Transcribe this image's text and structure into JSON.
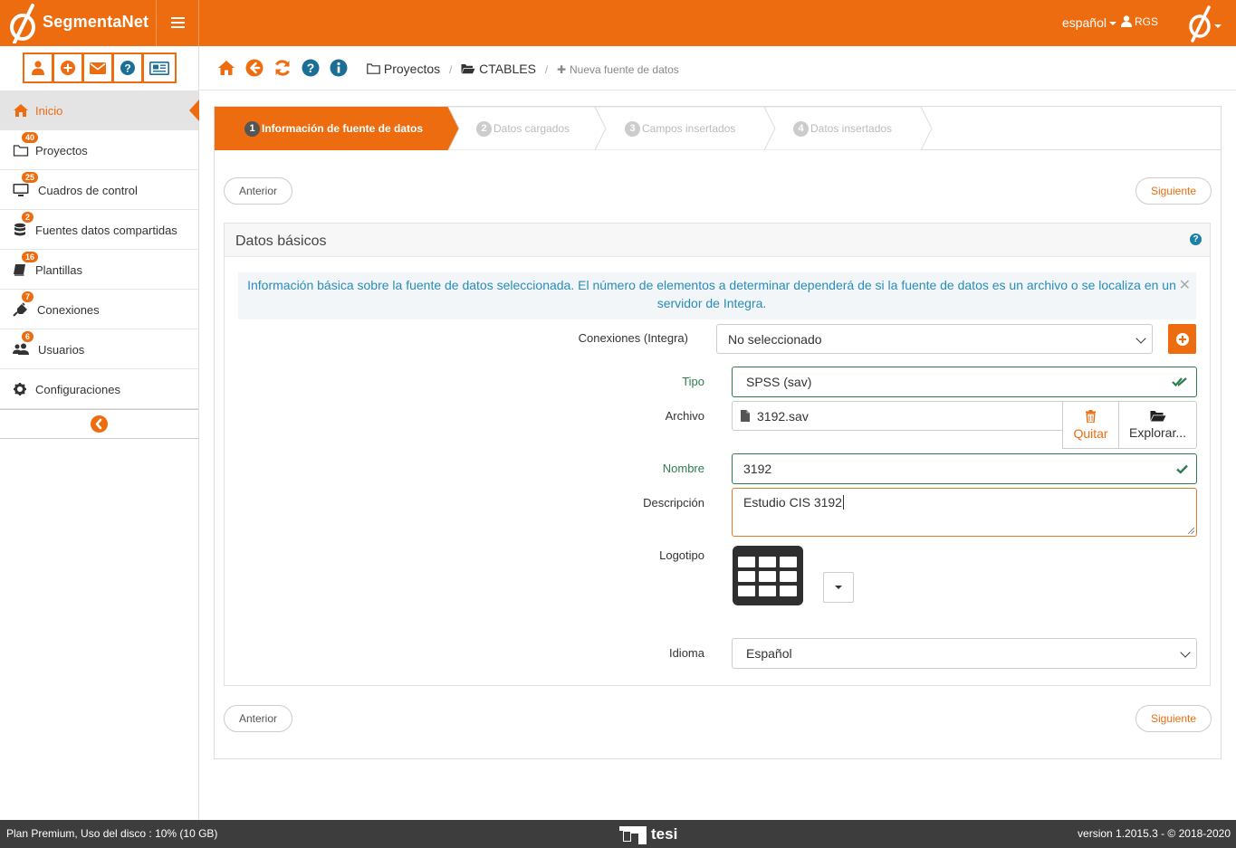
{
  "brand": {
    "name": "SegmentaNet"
  },
  "topbar": {
    "language": "español",
    "user": "RGS"
  },
  "quick_actions": [
    "user-icon",
    "plus-circle-icon",
    "envelope-icon",
    "question-circle-icon",
    "newspaper-icon"
  ],
  "sidebar": {
    "items": [
      {
        "label": "Inicio",
        "badge": "",
        "icon": "home-icon",
        "active": true
      },
      {
        "label": "Proyectos",
        "badge": "40",
        "icon": "folder-icon"
      },
      {
        "label": "Cuadros de control",
        "badge": "25",
        "icon": "desktop-icon"
      },
      {
        "label": "Fuentes datos compartidas",
        "badge": "2",
        "icon": "database-icon"
      },
      {
        "label": "Plantillas",
        "badge": "16",
        "icon": "book-icon"
      },
      {
        "label": "Conexiones",
        "badge": "7",
        "icon": "plug-icon"
      },
      {
        "label": "Usuarios",
        "badge": "6",
        "icon": "users-icon"
      },
      {
        "label": "Configuraciones",
        "badge": "",
        "icon": "cog-icon"
      }
    ]
  },
  "breadcrumb": {
    "items": [
      "Proyectos",
      "CTABLES",
      "Nueva fuente de datos"
    ]
  },
  "wizard": {
    "steps": [
      {
        "num": "1",
        "label": "Información de fuente de datos"
      },
      {
        "num": "2",
        "label": "Datos cargados"
      },
      {
        "num": "3",
        "label": "Campos insertados"
      },
      {
        "num": "4",
        "label": "Datos insertados"
      }
    ],
    "prev_label": "Anterior",
    "next_label": "Siguiente"
  },
  "form": {
    "section_title": "Datos básicos",
    "info_text": "Información básica sobre la fuente de datos seleccionada. El número de elementos a determinar dependerá de si la fuente de datos es un archivo o se localiza en un servidor de Integra.",
    "connections_label": "Conexiones (Integra)",
    "connections_value": "No seleccionado",
    "tipo_label": "Tipo",
    "tipo_value": "SPSS (sav)",
    "archivo_label": "Archivo",
    "archivo_value": "3192.sav",
    "quitar_label": "Quitar",
    "explorar_label": "Explorar...",
    "nombre_label": "Nombre",
    "nombre_value": "3192",
    "descripcion_label": "Descripción",
    "descripcion_value": "Estudio CIS 3192",
    "logotipo_label": "Logotipo",
    "idioma_label": "Idioma",
    "idioma_value": "Español"
  },
  "footer": {
    "plan": "Plan Premium, Uso del disco : 10% (10 GB)",
    "brand": "tesi",
    "version": "version 1.2015.3 - © 2018-2020"
  },
  "colors": {
    "accent": "#ec6c0f",
    "valid": "#2e7d4f",
    "info": "#2a8cb7",
    "footer": "#3d3d3d"
  }
}
